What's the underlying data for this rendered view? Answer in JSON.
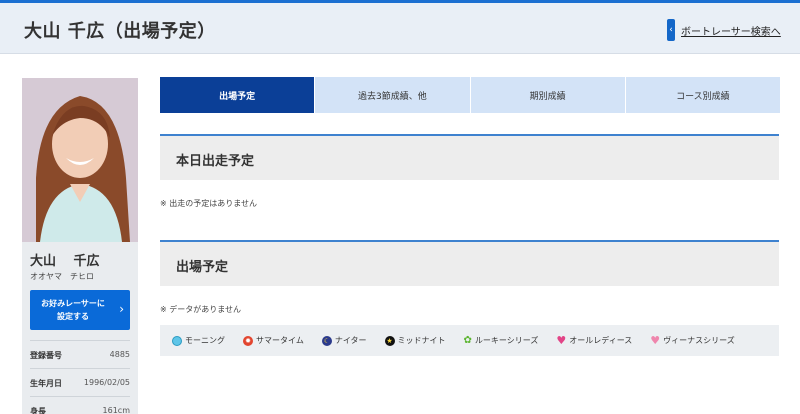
{
  "header": {
    "title": "大山 千広（出場予定）",
    "search_link": "ボートレーサー検索へ"
  },
  "sidebar": {
    "name": "大山　 千広",
    "kana": "オオヤマ　チヒロ",
    "favorite_button": "お好みレーサーに\n設定する",
    "info": [
      {
        "label": "登録番号",
        "value": "4885"
      },
      {
        "label": "生年月日",
        "value": "1996/02/05"
      },
      {
        "label": "身長",
        "value": "161cm"
      }
    ]
  },
  "tabs": [
    {
      "label": "出場予定",
      "active": true
    },
    {
      "label": "過去3節成績、他",
      "active": false
    },
    {
      "label": "期別成績",
      "active": false
    },
    {
      "label": "コース別成績",
      "active": false
    }
  ],
  "sections": {
    "today": {
      "title": "本日出走予定",
      "note": "※ 出走の予定はありません"
    },
    "schedule": {
      "title": "出場予定",
      "note": "※ データがありません"
    }
  },
  "legend": [
    {
      "label": "モーニング",
      "icon": "morning-icon"
    },
    {
      "label": "サマータイム",
      "icon": "summer-time-icon"
    },
    {
      "label": "ナイター",
      "icon": "nighter-icon"
    },
    {
      "label": "ミッドナイト",
      "icon": "midnight-icon"
    },
    {
      "label": "ルーキーシリーズ",
      "icon": "rookie-icon"
    },
    {
      "label": "オールレディース",
      "icon": "all-ladies-icon"
    },
    {
      "label": "ヴィーナスシリーズ",
      "icon": "venus-icon"
    }
  ],
  "colors": {
    "accent": "#0b3f97",
    "button": "#0a6ad8",
    "tab": "#d3e3f7"
  }
}
